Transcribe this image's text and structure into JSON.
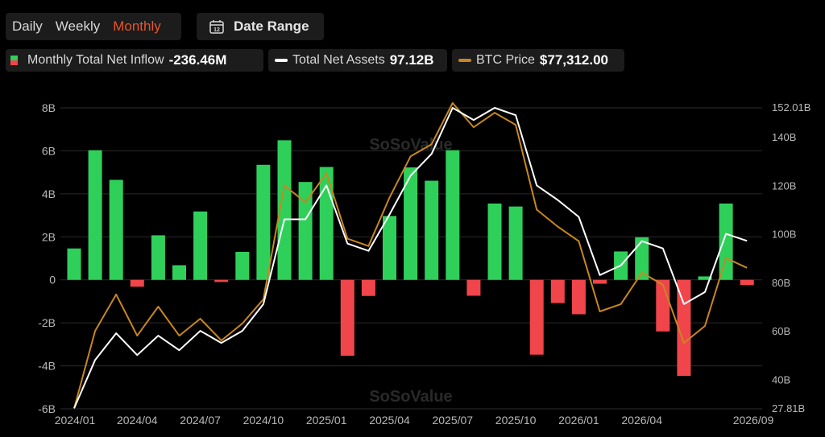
{
  "toolbar": {
    "tabs": [
      {
        "label": "Daily",
        "active": false
      },
      {
        "label": "Weekly",
        "active": false
      },
      {
        "label": "Monthly",
        "active": true
      }
    ],
    "date_range_label": "Date Range",
    "calendar_day": "12"
  },
  "legend": {
    "inflow_label": "Monthly Total Net Inflow",
    "inflow_value": "-236.46M",
    "assets_label": "Total Net Assets",
    "assets_value": "97.12B",
    "btc_label": "BTC Price",
    "btc_value": "$77,312.00"
  },
  "watermark": "SoSoValue",
  "colors": {
    "positive": "#2fd05a",
    "negative": "#f0454a",
    "assets_line": "#ffffff",
    "btc_line": "#c8871e",
    "active_tab": "#e8542f"
  },
  "chart_data": {
    "type": "bar",
    "categories": [
      "2024/01",
      "2024/02",
      "2024/03",
      "2024/04",
      "2024/05",
      "2024/06",
      "2024/07",
      "2024/08",
      "2024/09",
      "2024/10",
      "2024/11",
      "2024/12",
      "2025/01",
      "2025/02",
      "2025/03",
      "2025/04",
      "2025/05",
      "2025/06",
      "2025/07",
      "2025/08",
      "2025/09",
      "2025/10",
      "2025/11",
      "2025/12",
      "2026/01",
      "2026/02",
      "2026/03",
      "2026/04",
      "2026/05",
      "2026/06",
      "2026/07",
      "2026/08",
      "2026/09"
    ],
    "x_tick_labels": [
      "2024/01",
      "2024/04",
      "2024/07",
      "2024/10",
      "2025/01",
      "2025/04",
      "2025/07",
      "2025/10",
      "2026/01",
      "2026/04",
      "2026/09"
    ],
    "x_tick_indices": [
      0,
      3,
      6,
      9,
      12,
      15,
      18,
      21,
      24,
      27,
      32
    ],
    "left_axis": {
      "ticks": [
        "8B",
        "6B",
        "4B",
        "2B",
        "0",
        "-2B",
        "-4B",
        "-6B"
      ],
      "tick_values": [
        8,
        6,
        4,
        2,
        0,
        -2,
        -4,
        -6
      ],
      "ylim": [
        -6,
        8
      ],
      "unit": "B"
    },
    "right_axis": {
      "ticks": [
        "152.01B",
        "140B",
        "120B",
        "100B",
        "80B",
        "60B",
        "40B",
        "27.81B"
      ],
      "tick_values": [
        152.01,
        140,
        120,
        100,
        80,
        60,
        40,
        27.81
      ],
      "ylim": [
        27.81,
        152.01
      ]
    },
    "grid": true,
    "series": [
      {
        "name": "Monthly Total Net Inflow",
        "type": "bar",
        "axis": "left",
        "values": [
          1.46,
          6.03,
          4.65,
          -0.32,
          2.07,
          0.68,
          3.18,
          -0.1,
          1.3,
          5.35,
          6.49,
          4.55,
          5.25,
          -3.53,
          -0.75,
          2.97,
          5.23,
          4.61,
          6.03,
          -0.74,
          3.55,
          3.41,
          -3.48,
          -1.08,
          -1.6,
          -0.18,
          1.32,
          1.98,
          -2.4,
          -4.47,
          0.16,
          3.55,
          -0.24
        ]
      },
      {
        "name": "Total Net Assets",
        "type": "line",
        "axis": "right",
        "values": [
          28,
          48,
          59,
          50,
          58,
          52,
          60,
          55,
          60,
          71,
          106,
          106,
          120,
          96,
          93,
          108,
          124,
          133,
          152,
          147,
          152,
          149,
          120,
          114,
          107,
          83,
          87,
          97,
          94,
          71,
          76,
          100,
          97.12
        ]
      },
      {
        "name": "BTC Price",
        "type": "line",
        "axis": "right",
        "values": [
          28,
          60,
          75,
          58,
          70,
          58,
          65,
          56,
          63,
          73,
          120,
          113,
          125,
          98,
          95,
          115,
          132,
          137,
          154,
          144,
          150,
          145,
          110,
          103,
          97,
          68,
          71,
          84,
          79,
          55,
          62,
          90,
          86
        ]
      }
    ]
  }
}
